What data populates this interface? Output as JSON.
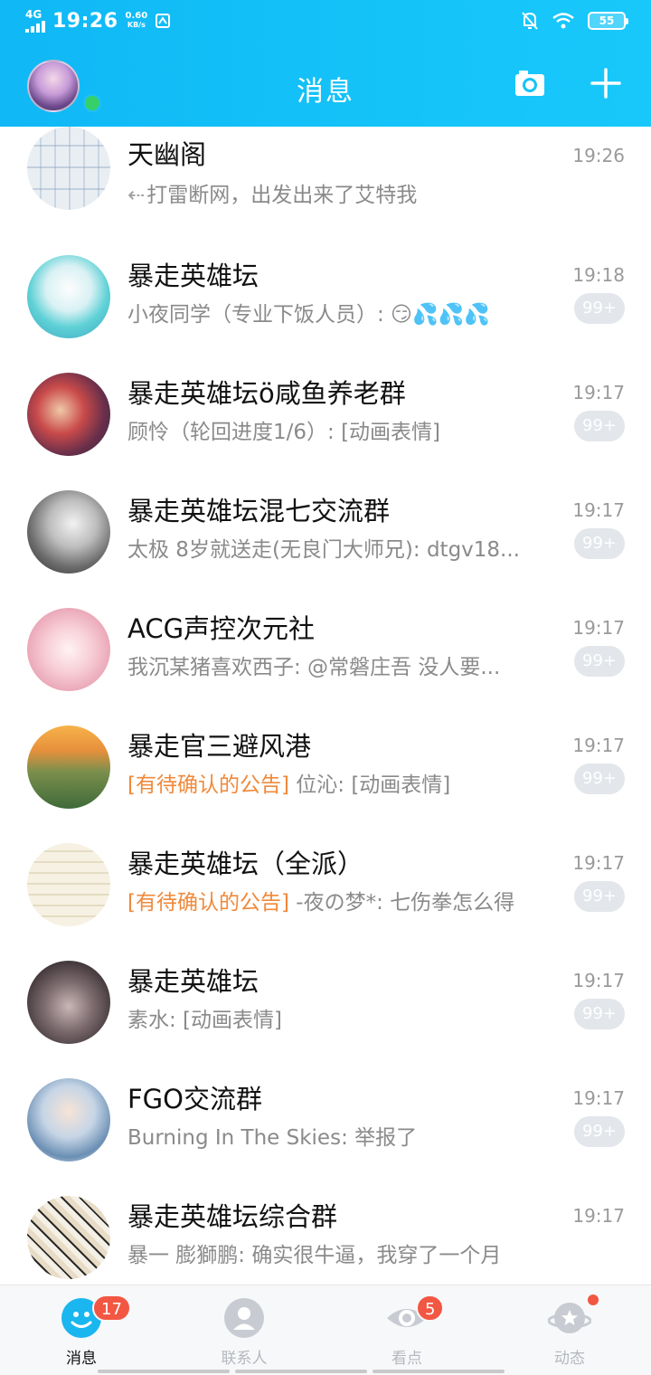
{
  "status": {
    "network": "4G",
    "time": "19:26",
    "speed_value": "0.60",
    "speed_unit": "KB/s",
    "battery": "55"
  },
  "header": {
    "title": "消息"
  },
  "conversations": [
    {
      "name": "天幽阁",
      "preview": "打雷断网，出发出来了艾特我",
      "time": "19:26",
      "badge": "",
      "sent_icon": "reply-arrow-icon"
    },
    {
      "name": "暴走英雄坛",
      "preview": "小夜同学（专业下饭人员）: 😏💦💦💦",
      "time": "19:18",
      "badge": "99+"
    },
    {
      "name": "暴走英雄坛ö咸鱼养老群",
      "preview": "顾怜（轮回进度1/6）: [动画表情]",
      "time": "19:17",
      "badge": "99+"
    },
    {
      "name": "暴走英雄坛混七交流群",
      "preview": "太极 8岁就送走(无良门大师兄): dtgv18...",
      "time": "19:17",
      "badge": "99+"
    },
    {
      "name": "ACG声控次元社",
      "preview": "我沉某猪喜欢西子: @常磐庄吾 没人要...",
      "time": "19:17",
      "badge": "99+"
    },
    {
      "name": "暴走官三避风港",
      "notice": "[有待确认的公告]",
      "preview": " 位沁: [动画表情]",
      "time": "19:17",
      "badge": "99+"
    },
    {
      "name": "暴走英雄坛（全派）",
      "notice": "[有待确认的公告]",
      "preview": " -夜の梦*: 七伤拳怎么得",
      "time": "19:17",
      "badge": "99+"
    },
    {
      "name": "暴走英雄坛",
      "preview": "素水: [动画表情]",
      "time": "19:17",
      "badge": "99+"
    },
    {
      "name": "FGO交流群",
      "preview": "Burning In The Skies: 举报了",
      "time": "19:17",
      "badge": "99+"
    },
    {
      "name": "暴走英雄坛综合群",
      "preview": "暴一 膨獅鹏: 确实很牛逼，我穿了一个月",
      "time": "19:17",
      "badge": ""
    }
  ],
  "tabs": [
    {
      "label": "消息",
      "badge": "17",
      "icon": "penguin-chat-icon",
      "active": true
    },
    {
      "label": "联系人",
      "badge": "",
      "icon": "person-icon",
      "active": false
    },
    {
      "label": "看点",
      "badge": "5",
      "icon": "eye-icon",
      "active": false
    },
    {
      "label": "动态",
      "badge": "",
      "dot": true,
      "icon": "planet-star-icon",
      "active": false
    }
  ],
  "colors": {
    "header": "#14c3f8",
    "notice": "#f0893a",
    "badge_red": "#f25743",
    "unread_badge": "#e3e6ea"
  }
}
